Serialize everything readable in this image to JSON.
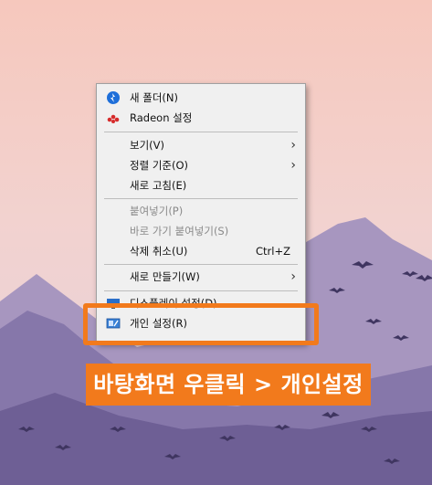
{
  "menu": {
    "items": [
      {
        "label": "새 폴더(N)",
        "icon": "blue-circle-icon"
      },
      {
        "label": "Radeon 설정",
        "icon": "radeon-logo-icon"
      },
      {
        "label": "보기(V)",
        "has_submenu": true
      },
      {
        "label": "정렬 기준(O)",
        "has_submenu": true
      },
      {
        "label": "새로 고침(E)"
      },
      {
        "label": "붙여넣기(P)",
        "disabled": true
      },
      {
        "label": "바로 가기 붙여넣기(S)",
        "disabled": true
      },
      {
        "label": "삭제 취소(U)",
        "shortcut": "Ctrl+Z"
      },
      {
        "label": "새로 만들기(W)",
        "has_submenu": true
      },
      {
        "label": "디스플레이 설정(D)",
        "icon": "display-icon"
      },
      {
        "label": "개인 설정(R)",
        "icon": "personalize-icon"
      }
    ],
    "submenu_arrow": "›"
  },
  "caption": {
    "text": "바탕화면 우클릭 > 개인설정"
  },
  "colors": {
    "accent_orange": "#f27a1c",
    "menu_bg": "#f0f0f0",
    "sky_top": "#f4c9c0",
    "mountain": "#8f7fae"
  }
}
